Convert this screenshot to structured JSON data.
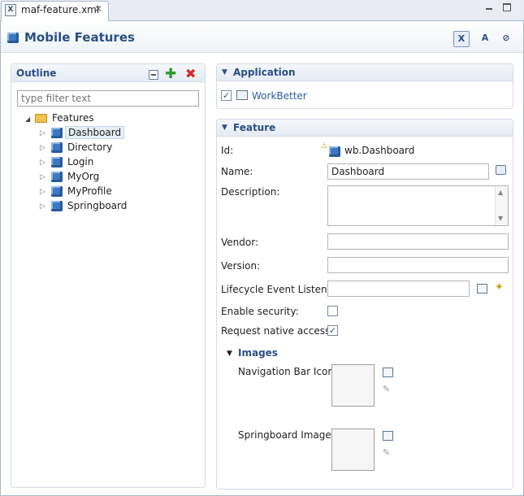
{
  "tab": {
    "title": "maf-feature.xml"
  },
  "header": {
    "title": "Mobile Features"
  },
  "outline": {
    "title": "Outline",
    "filter_placeholder": "type filter text",
    "root": "Features",
    "items": [
      "Dashboard",
      "Directory",
      "Login",
      "MyOrg",
      "MyProfile",
      "Springboard"
    ],
    "selected": "Dashboard"
  },
  "application": {
    "title": "Application",
    "item": "WorkBetter"
  },
  "feature": {
    "title": "Feature",
    "id_label": "Id:",
    "id_value": "wb.Dashboard",
    "name_label": "Name:",
    "name_value": "Dashboard",
    "description_label": "Description:",
    "vendor_label": "Vendor:",
    "version_label": "Version:",
    "lifecycle_label": "Lifecycle Event Listener:",
    "enable_security_label": "Enable security:",
    "native_access_label": "Request native access:",
    "images_title": "Images",
    "nav_icon_label": "Navigation Bar Icon:",
    "springboard_label": "Springboard Image:"
  },
  "icons": {
    "tab": "xml-file-icon",
    "close": "close-icon",
    "cube": "feature-cube-icon"
  },
  "colors": {
    "accent": "#2a4f85",
    "link": "#2a5db0"
  }
}
